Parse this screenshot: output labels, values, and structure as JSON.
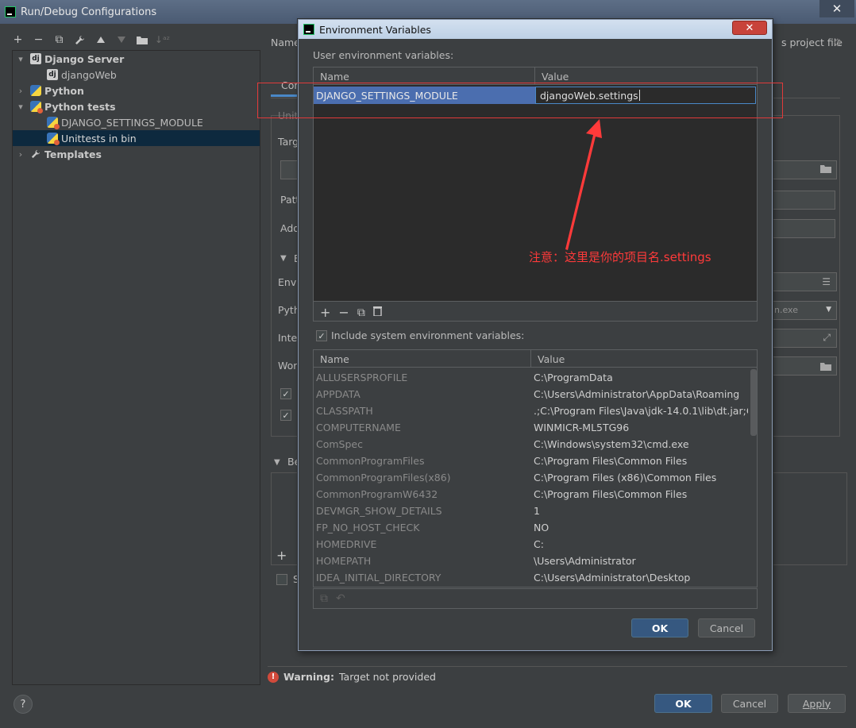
{
  "window": {
    "title": "Run/Debug Configurations",
    "close_glyph": "✕"
  },
  "left_toolbar": {
    "icons": [
      "add-icon",
      "remove-icon",
      "copy-icon",
      "wrench-icon",
      "move-up-icon",
      "move-down-icon",
      "new-folder-icon",
      "sort-icon"
    ],
    "glyphs": [
      "+",
      "−",
      "⧉",
      "🔧",
      "▲",
      "▼",
      "📁",
      "↓"
    ]
  },
  "tree": {
    "items": [
      {
        "label": "Django Server",
        "icon": "django-icon",
        "icon_glyph": "dj",
        "bold": true,
        "expander": "▾"
      },
      {
        "label": "djangoWeb",
        "icon": "django-icon",
        "icon_glyph": "dj",
        "bold": false,
        "expander": ""
      },
      {
        "label": "Python",
        "icon": "python-icon",
        "bold": true,
        "expander": "›"
      },
      {
        "label": "Python tests",
        "icon": "python-tests-icon",
        "bold": true,
        "expander": "▾"
      },
      {
        "label": "DJANGO_SETTINGS_MODULE",
        "icon": "python-tests-icon",
        "bold": false,
        "expander": ""
      },
      {
        "label": "Unittests in bin",
        "icon": "python-tests-icon",
        "bold": false,
        "expander": "",
        "selected": true
      },
      {
        "label": "Templates",
        "icon": "wrench-icon",
        "bold": true,
        "expander": "›"
      }
    ]
  },
  "right_panel": {
    "name_label": "Name",
    "project_file_label": "s project file",
    "tab_label": "Con",
    "unit_label": "Unit",
    "target_label": "Targ",
    "pattern_label": "Patt",
    "additional_label": "Add",
    "environment_label": "Envi",
    "python_label": "Pyth",
    "interpreter_label": "Inter",
    "working_label": "Wor",
    "interpreter_value_tail": "n.exe",
    "before_launch_label": "Be",
    "add_glyph": "+",
    "s_label": "S"
  },
  "warning": {
    "label": "Warning:",
    "text": "Target not provided",
    "icon_glyph": "!"
  },
  "help": {
    "glyph": "?"
  },
  "main_buttons": {
    "ok": "OK",
    "cancel": "Cancel",
    "apply": "Apply"
  },
  "dialog": {
    "title": "Environment Variables",
    "close_glyph": "✕",
    "user_section_label": "User environment variables:",
    "user_table": {
      "headers": [
        "Name",
        "Value"
      ],
      "rows": [
        {
          "name": "DJANGO_SETTINGS_MODULE",
          "value": "djangoWeb.settings"
        }
      ]
    },
    "user_toolbar_glyphs": [
      "+",
      "−",
      "⧉",
      "🗑"
    ],
    "include_system_label": "Include system environment variables:",
    "include_system_checked": true,
    "system_table": {
      "headers": [
        "Name",
        "Value"
      ],
      "rows": [
        {
          "name": "ALLUSERSPROFILE",
          "value": "C:\\ProgramData"
        },
        {
          "name": "APPDATA",
          "value": "C:\\Users\\Administrator\\AppData\\Roaming"
        },
        {
          "name": "CLASSPATH",
          "value": ".;C:\\Program Files\\Java\\jdk-14.0.1\\lib\\dt.jar;C..."
        },
        {
          "name": "COMPUTERNAME",
          "value": "WINMICR-ML5TG96"
        },
        {
          "name": "ComSpec",
          "value": "C:\\Windows\\system32\\cmd.exe"
        },
        {
          "name": "CommonProgramFiles",
          "value": "C:\\Program Files\\Common Files"
        },
        {
          "name": "CommonProgramFiles(x86)",
          "value": "C:\\Program Files (x86)\\Common Files"
        },
        {
          "name": "CommonProgramW6432",
          "value": "C:\\Program Files\\Common Files"
        },
        {
          "name": "DEVMGR_SHOW_DETAILS",
          "value": "1"
        },
        {
          "name": "FP_NO_HOST_CHECK",
          "value": "NO"
        },
        {
          "name": "HOMEDRIVE",
          "value": "C:"
        },
        {
          "name": "HOMEPATH",
          "value": "\\Users\\Administrator"
        },
        {
          "name": "IDEA_INITIAL_DIRECTORY",
          "value": "C:\\Users\\Administrator\\Desktop"
        }
      ]
    },
    "system_toolbar_glyphs": [
      "⧉",
      "↶"
    ],
    "ok": "OK",
    "cancel": "Cancel"
  },
  "annotation": {
    "text": "注意：这里是你的项目名.settings",
    "color": "#ff3a3a"
  }
}
